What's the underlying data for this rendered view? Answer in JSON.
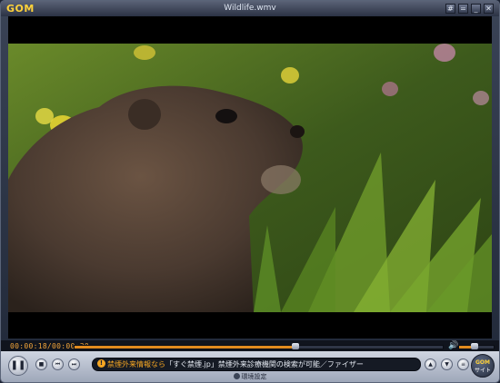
{
  "app": {
    "logo": "GOM",
    "title": "Wildlife.wmv"
  },
  "window_buttons": [
    {
      "name": "pin-icon",
      "glyph": "#"
    },
    {
      "name": "restore-icon",
      "glyph": "="
    },
    {
      "name": "minimize-icon",
      "glyph": "_"
    },
    {
      "name": "close-icon",
      "glyph": "✕"
    }
  ],
  "seek": {
    "timecode": "00:00:18/00:00:30",
    "progress": 0.6,
    "volume": 0.45,
    "volume_icon": "speaker-icon"
  },
  "controls": {
    "play_pause_icon": "pause-icon",
    "stop_icon": "stop-icon",
    "prev_icon": "previous-icon",
    "next_icon": "next-icon",
    "ticker_highlight": "禁煙外来情報なら",
    "ticker_text": "「すぐ禁煙.jp」禁煙外来診療機関の検索が可能／ファイザー",
    "settings_label": "環境設定",
    "right_buttons": [
      "open-icon",
      "playlist-icon",
      "menu-icon"
    ],
    "gom_site_a": "GOM",
    "gom_site_b": "サイト"
  },
  "colors": {
    "accent": "#f5a623",
    "timecode": "#f2a53a",
    "frame": "#2b3244"
  }
}
